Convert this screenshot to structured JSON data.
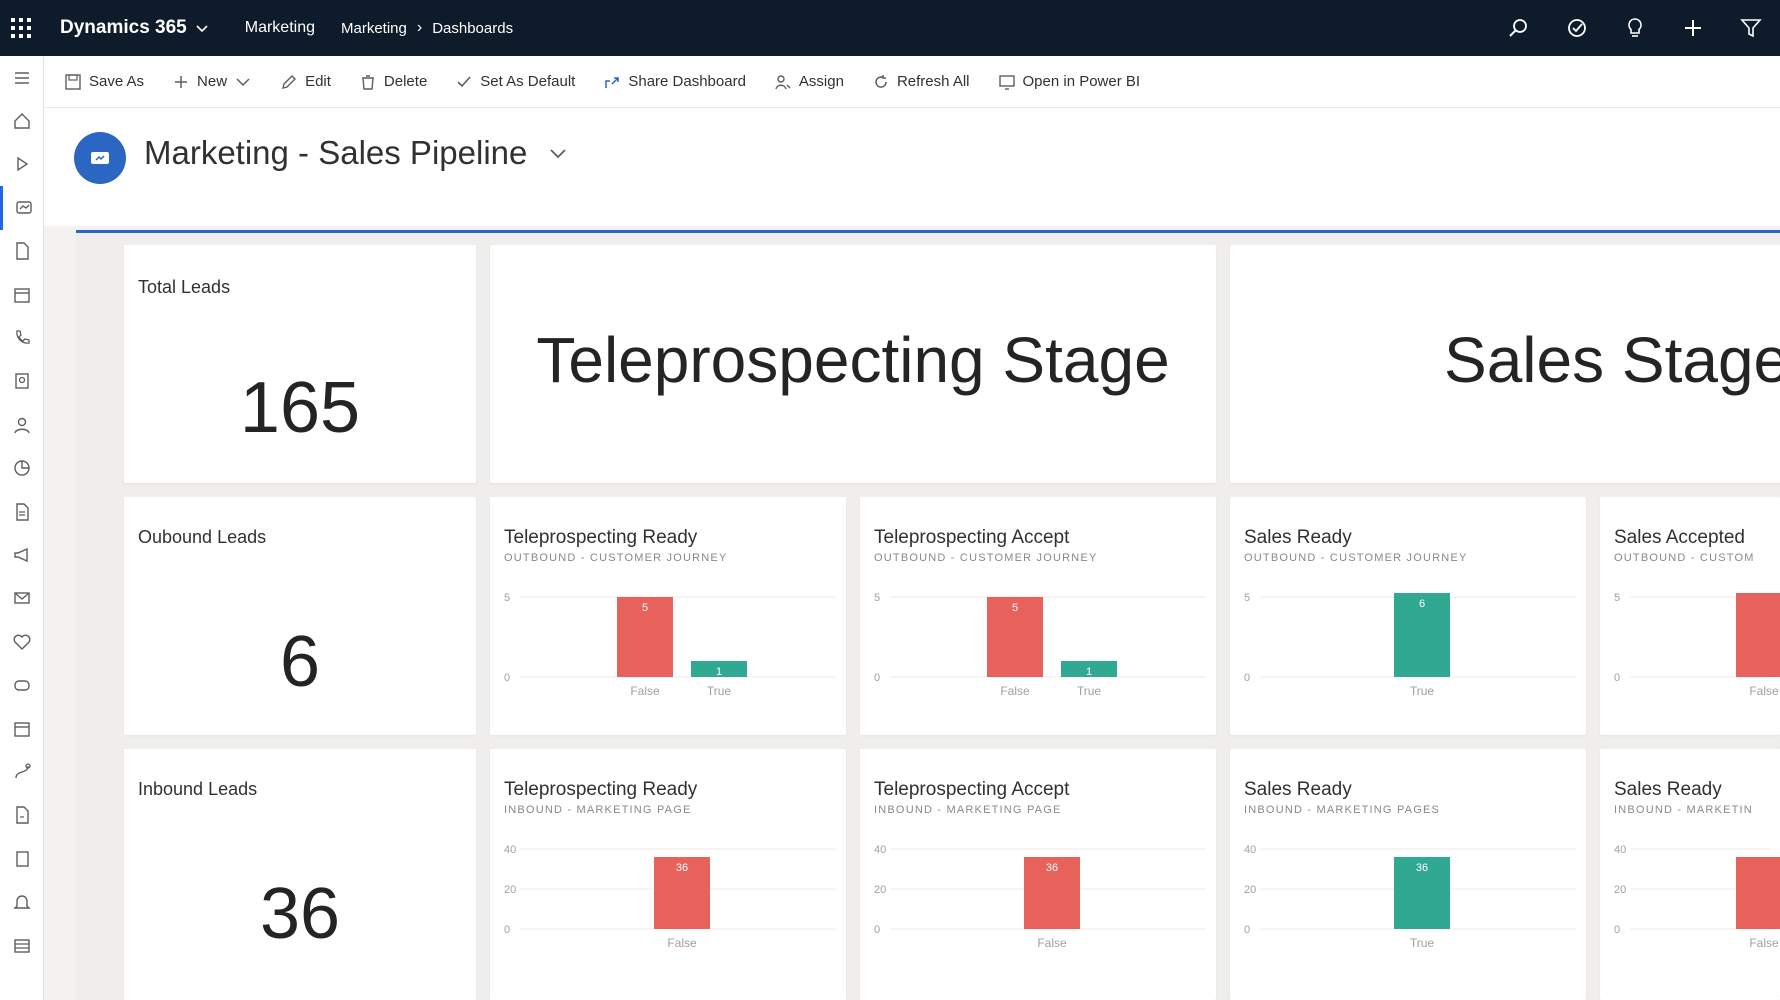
{
  "topbar": {
    "brand": "Dynamics 365",
    "app": "Marketing",
    "breadcrumb": [
      "Marketing",
      "Dashboards"
    ]
  },
  "commands": [
    {
      "label": "Save As",
      "icon": "save-icon"
    },
    {
      "label": "New",
      "icon": "plus-icon"
    },
    {
      "label": "Edit",
      "icon": "pencil-icon"
    },
    {
      "label": "Delete",
      "icon": "trash-icon"
    },
    {
      "label": "Set As Default",
      "icon": "check-icon"
    },
    {
      "label": "Share Dashboard",
      "icon": "share-icon"
    },
    {
      "label": "Assign",
      "icon": "assign-icon"
    },
    {
      "label": "Refresh All",
      "icon": "refresh-icon"
    },
    {
      "label": "Open in Power BI",
      "icon": "powerbi-icon"
    }
  ],
  "dashboard": {
    "title": "Marketing - Sales Pipeline"
  },
  "kpis": {
    "total": {
      "label": "Total Leads",
      "value": "165"
    },
    "outbound": {
      "label": "Oubound Leads",
      "value": "6"
    },
    "inbound": {
      "label": "Inbound Leads",
      "value": "36"
    }
  },
  "stages": {
    "teleprospecting": "Teleprospecting Stage",
    "sales": "Sales Stage"
  },
  "colors": {
    "false_bar": "#e8625c",
    "true_bar": "#30a892",
    "accent": "#2b66c2"
  },
  "chart_data": [
    {
      "id": "c1",
      "type": "bar",
      "title": "Teleprospecting Ready",
      "subtitle": "OUTBOUND - CUSTOMER JOURNEY",
      "categories": [
        "False",
        "True"
      ],
      "values": [
        5,
        1
      ],
      "labels": [
        "5",
        "1"
      ],
      "ylim": [
        0,
        5
      ],
      "yticks": [
        0,
        5
      ]
    },
    {
      "id": "c2",
      "type": "bar",
      "title": "Teleprospecting Accept",
      "subtitle": "OUTBOUND - CUSTOMER JOURNEY",
      "categories": [
        "False",
        "True"
      ],
      "values": [
        5,
        1
      ],
      "labels": [
        "5",
        "1"
      ],
      "ylim": [
        0,
        5
      ],
      "yticks": [
        0,
        5
      ]
    },
    {
      "id": "c3",
      "type": "bar",
      "title": "Sales Ready",
      "subtitle": "OUTBOUND - CUSTOMER JOURNEY",
      "categories": [
        "True"
      ],
      "values": [
        6
      ],
      "labels": [
        "6"
      ],
      "ylim": [
        0,
        5
      ],
      "yticks": [
        0,
        5
      ]
    },
    {
      "id": "c4",
      "type": "bar",
      "title": "Sales Accepted",
      "subtitle": "OUTBOUND - CUSTOM",
      "categories": [
        "False"
      ],
      "values": [
        6
      ],
      "labels": [
        ""
      ],
      "ylim": [
        0,
        5
      ],
      "yticks": [
        0,
        5
      ]
    },
    {
      "id": "c5",
      "type": "bar",
      "title": "Teleprospecting Ready",
      "subtitle": "INBOUND - MARKETING PAGE",
      "categories": [
        "False"
      ],
      "values": [
        36
      ],
      "labels": [
        "36"
      ],
      "ylim": [
        0,
        40
      ],
      "yticks": [
        0,
        20,
        40
      ]
    },
    {
      "id": "c6",
      "type": "bar",
      "title": "Teleprospecting Accept",
      "subtitle": "INBOUND - MARKETING PAGE",
      "categories": [
        "False"
      ],
      "values": [
        36
      ],
      "labels": [
        "36"
      ],
      "ylim": [
        0,
        40
      ],
      "yticks": [
        0,
        20,
        40
      ]
    },
    {
      "id": "c7",
      "type": "bar",
      "title": "Sales Ready",
      "subtitle": "INBOUND - MARKETING PAGES",
      "categories": [
        "True"
      ],
      "values": [
        36
      ],
      "labels": [
        "36"
      ],
      "ylim": [
        0,
        40
      ],
      "yticks": [
        0,
        20,
        40
      ]
    },
    {
      "id": "c8",
      "type": "bar",
      "title": "Sales Ready",
      "subtitle": "INBOUND - MARKETIN",
      "categories": [
        "False"
      ],
      "values": [
        36
      ],
      "labels": [
        ""
      ],
      "ylim": [
        0,
        40
      ],
      "yticks": [
        0,
        20,
        40
      ]
    }
  ]
}
